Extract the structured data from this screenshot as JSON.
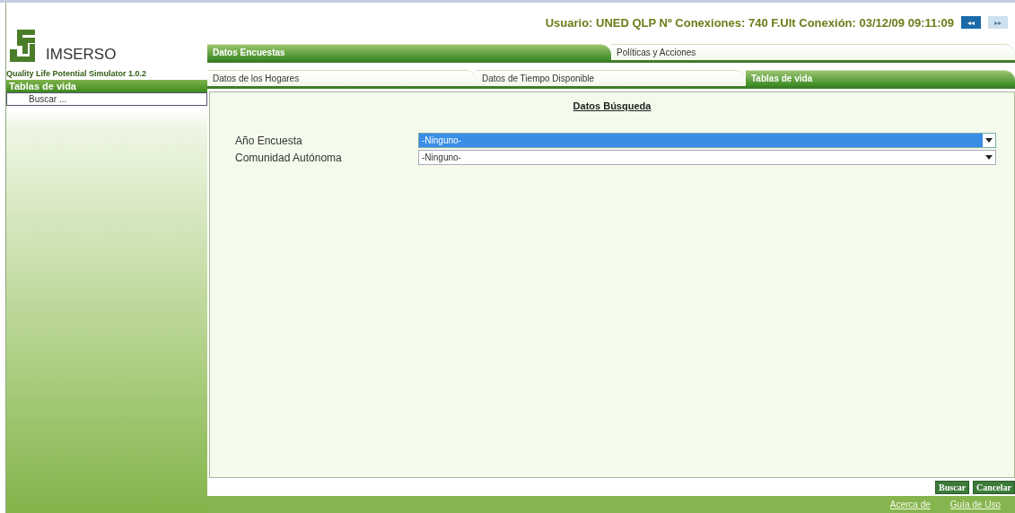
{
  "header": {
    "status": "Usuario: UNED QLP Nº Conexiones: 740 F.Ult Conexión: 03/12/09 09:11:09",
    "nav_buttons": [
      {
        "label": "◂◂",
        "disabled": false
      },
      {
        "label": "▸▸",
        "disabled": true
      }
    ]
  },
  "sidebar": {
    "logo_text": "IMSERSO",
    "app_name": "Quality Life Potential Simulator 1.0.2",
    "section_title": "Tablas de vida",
    "items": [
      "Buscar ..."
    ]
  },
  "tabs": [
    {
      "label": "Datos Encuestas",
      "selected": true
    },
    {
      "label": "Políticas y Acciones",
      "selected": false
    }
  ],
  "subtabs": [
    {
      "label": "Datos de los Hogares",
      "selected": false
    },
    {
      "label": "Datos de Tiempo Disponible",
      "selected": false
    },
    {
      "label": "Tablas de vida",
      "selected": true
    }
  ],
  "panel": {
    "title": "Datos Búsqueda",
    "fields": [
      {
        "label": "Año Encuesta",
        "value": "-Ninguno-",
        "selected": true
      },
      {
        "label": "Comunidad Autónoma",
        "value": "-Ninguno-",
        "selected": false
      }
    ]
  },
  "buttons": [
    "Buscar",
    "Cancelar"
  ],
  "footer_links": [
    "Acerca de",
    "Guía de Uso"
  ]
}
